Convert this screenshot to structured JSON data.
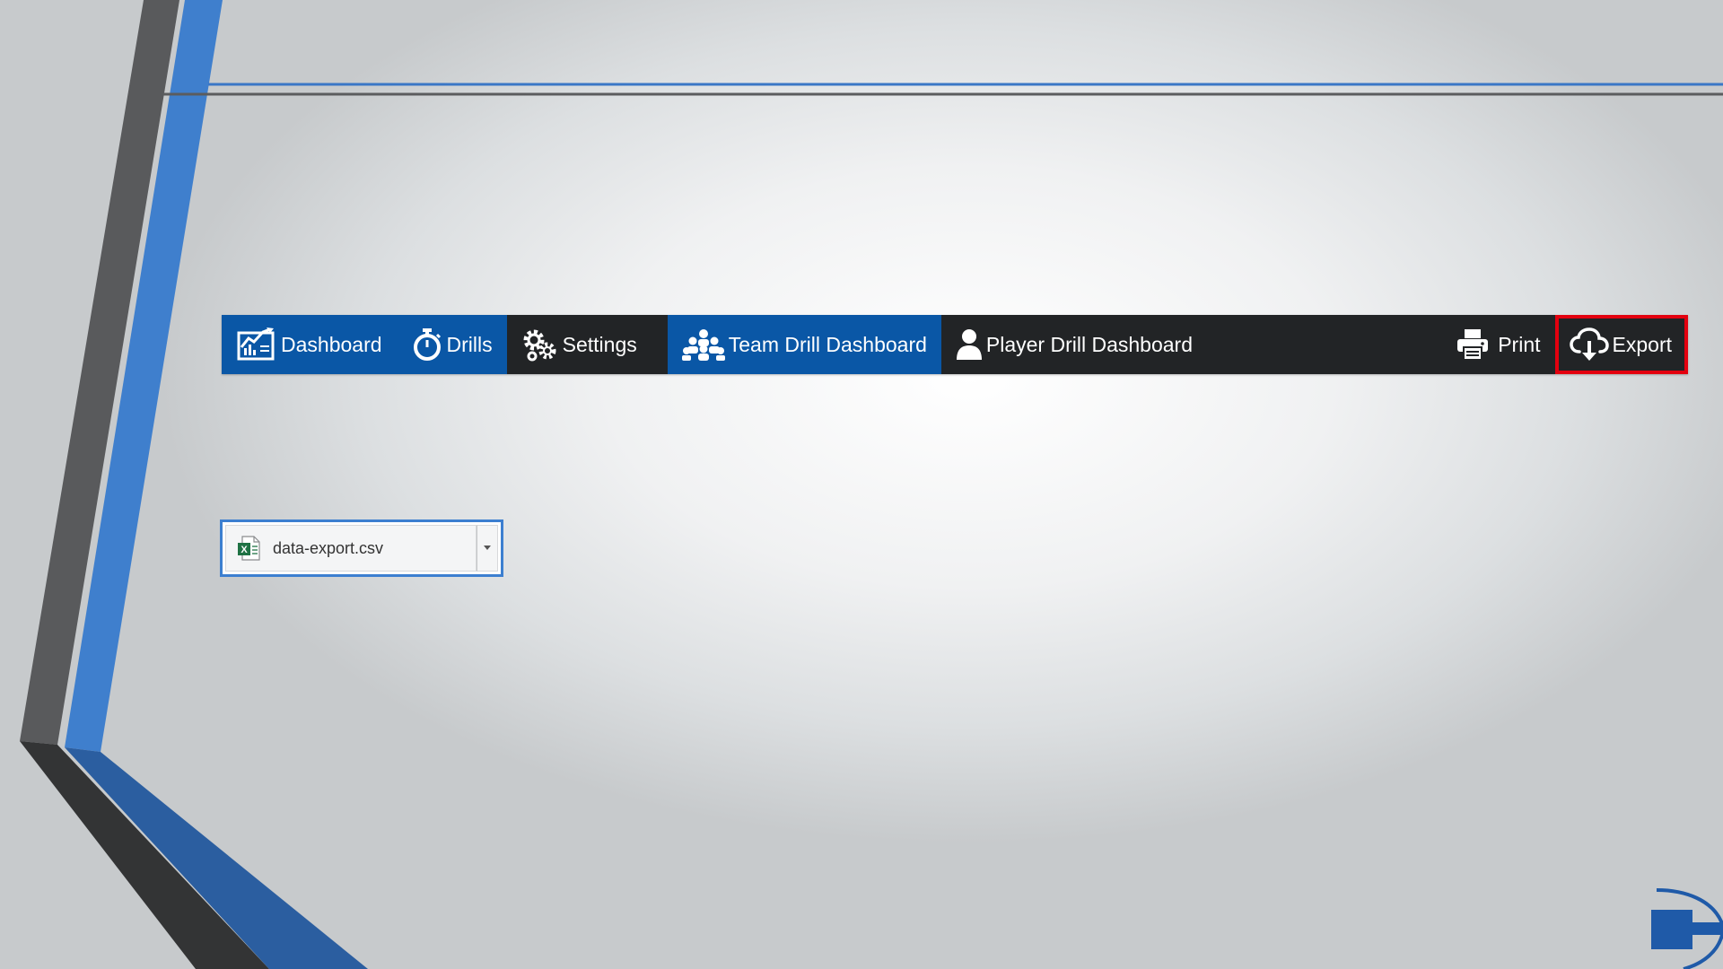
{
  "navbar": {
    "items": [
      {
        "label": "Dashboard",
        "icon": "dashboard-chart-icon",
        "active": true
      },
      {
        "label": "Drills",
        "icon": "stopwatch-icon",
        "active": true
      },
      {
        "label": "Settings",
        "icon": "gears-icon",
        "active": false
      },
      {
        "label": "Team Drill Dashboard",
        "icon": "team-icon",
        "active": true
      },
      {
        "label": "Player Drill Dashboard",
        "icon": "user-icon",
        "active": false
      },
      {
        "label": "Print",
        "icon": "printer-icon",
        "active": false
      },
      {
        "label": "Export",
        "icon": "cloud-download-icon",
        "active": false,
        "highlighted": true
      }
    ]
  },
  "download": {
    "filename": "data-export.csv",
    "icon": "excel-file-icon"
  },
  "colors": {
    "nav_background": "#222426",
    "nav_active": "#0a57a6",
    "highlight_outline": "#e3000f",
    "accent_blue": "#3c7fd0"
  }
}
